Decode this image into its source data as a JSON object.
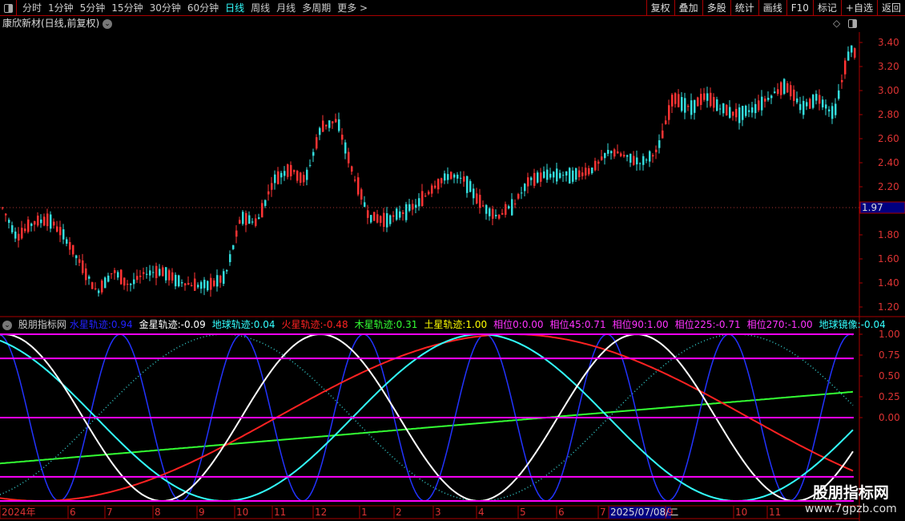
{
  "toolbar": {
    "periods": [
      "分时",
      "1分钟",
      "5分钟",
      "15分钟",
      "30分钟",
      "60分钟",
      "日线",
      "周线",
      "月线",
      "多周期",
      "更多 >"
    ],
    "active": "日线",
    "right_buttons": [
      "复权",
      "叠加",
      "多股",
      "统计",
      "画线",
      "F10",
      "标记",
      "+自选",
      "返回"
    ]
  },
  "title": "康欣新材(日线,前复权)",
  "price_axis": {
    "ticks": [
      "3.40",
      "3.20",
      "3.00",
      "2.80",
      "2.60",
      "2.40",
      "2.20",
      "1.80",
      "1.60",
      "1.40",
      "1.20"
    ],
    "current": "1.97"
  },
  "indicator": {
    "name": "股朋指标网",
    "items": [
      {
        "label": "水星轨迹:",
        "value": "0.94",
        "color": "#2222ff"
      },
      {
        "label": "金星轨迹:",
        "value": "-0.09",
        "color": "#ffffff"
      },
      {
        "label": "地球轨迹:",
        "value": "0.04",
        "color": "#33ffff"
      },
      {
        "label": "火星轨迹:",
        "value": "-0.48",
        "color": "#ff2222"
      },
      {
        "label": "木星轨迹:",
        "value": "0.31",
        "color": "#33ff33"
      },
      {
        "label": "土星轨迹:",
        "value": "1.00",
        "color": "#ffff00"
      },
      {
        "label": "相位0:",
        "value": "0.00",
        "color": "#ff33ff"
      },
      {
        "label": "相位45:",
        "value": "0.71",
        "color": "#ff33ff"
      },
      {
        "label": "相位90:",
        "value": "1.00",
        "color": "#ff33ff"
      },
      {
        "label": "相位225:",
        "value": "-0.71",
        "color": "#ff33ff"
      },
      {
        "label": "相位270:",
        "value": "-1.00",
        "color": "#ff33ff"
      },
      {
        "label": "地球镜像:",
        "value": "-0.04",
        "color": "#33ffff"
      }
    ],
    "axis_ticks": [
      "1.00",
      "0.75",
      "0.50",
      "0.25",
      "0.00"
    ]
  },
  "date_axis": [
    "2024年",
    "6",
    "7",
    "8",
    "9",
    "10",
    "11",
    "12",
    "1",
    "2",
    "3",
    "4",
    "5",
    "6",
    "7",
    "2025/07/08/二",
    "9",
    "10",
    "11"
  ],
  "watermark": {
    "name": "股朋指标网",
    "url": "www.7gpzb.com"
  },
  "chart_data": {
    "type": "candlestick",
    "price_samples": [
      2.05,
      1.78,
      1.9,
      1.93,
      1.78,
      1.55,
      1.32,
      1.5,
      1.38,
      1.48,
      1.5,
      1.42,
      1.38,
      1.38,
      1.45,
      1.95,
      1.9,
      2.25,
      2.35,
      2.25,
      2.7,
      2.75,
      2.3,
      1.95,
      1.92,
      1.98,
      2.05,
      2.2,
      2.3,
      2.25,
      2.05,
      1.95,
      2.05,
      2.25,
      2.3,
      2.3,
      2.3,
      2.35,
      2.5,
      2.45,
      2.4,
      2.5,
      2.95,
      2.85,
      2.95,
      2.85,
      2.8,
      2.85,
      2.95,
      3.05,
      2.85,
      2.95,
      2.8,
      3.35,
      3.25
    ],
    "ylim": [
      1.1,
      3.5
    ],
    "phase_levels": [
      1,
      0.71,
      0,
      -0.71,
      -1
    ],
    "indicator_ylim": [
      -1,
      1
    ]
  },
  "colors": {
    "up": "#ff3333",
    "down": "#33dddd",
    "grid": "#aa0000",
    "phase": "#ff00ff"
  }
}
